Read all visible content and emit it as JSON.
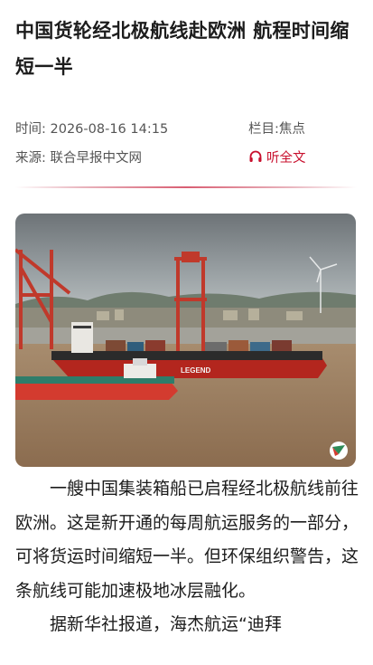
{
  "article": {
    "title": "中国货轮经北极航线赴欧洲 航程时间缩短一半",
    "meta": {
      "time_label": "时间:",
      "time_value": "2026-08-16 14:15",
      "column_label": "栏目:",
      "column_value": "焦点",
      "source_label": "来源:",
      "source_value": "联合早报中文网",
      "listen_label": "听全文"
    },
    "image": {
      "ship_hull_text": "LEGEND"
    },
    "paragraphs": [
      "一艘中国集装箱船已启程经北极航线前往欧洲。这是新开通的每周航运服务的一部分，可将货运时间缩短一半。但环保组织警告，这条航线可能加速极地冰层融化。",
      "据新华社报道，海杰航运“迪拜"
    ]
  },
  "icons": {
    "listen": "headphones-icon",
    "watermark": "app-logo-icon"
  },
  "colors": {
    "accent": "#c8102e",
    "meta_text": "#555555"
  }
}
